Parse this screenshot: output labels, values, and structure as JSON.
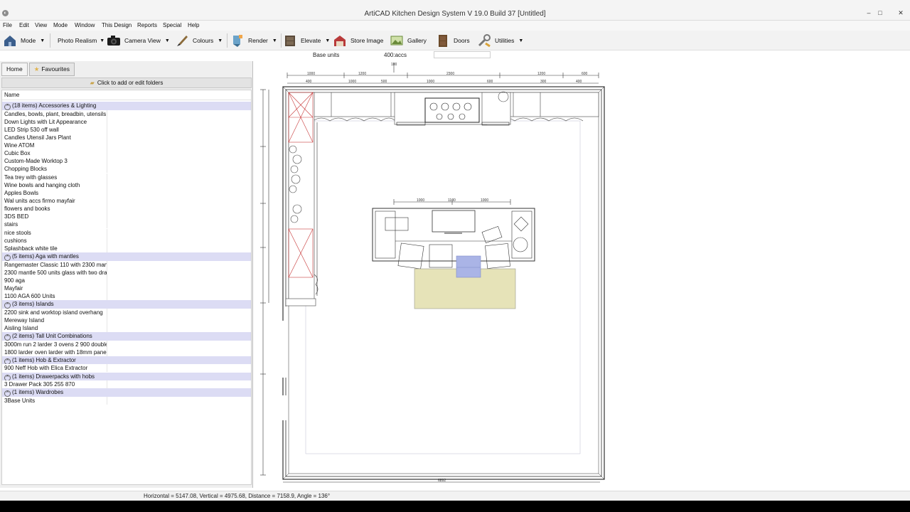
{
  "window": {
    "title": "ArtiCAD Kitchen Design System V 19.0 Build 37 [Untitled]",
    "controls": [
      "–",
      "□",
      "✕"
    ]
  },
  "menu": [
    "File",
    "Edit",
    "View",
    "Mode",
    "Window",
    "This Design",
    "Reports",
    "Special",
    "Help"
  ],
  "toolbar": [
    {
      "label": "Mode",
      "icon": "house-icon"
    },
    {
      "label": "Photo Realism",
      "icon": "photo-realism-icon"
    },
    {
      "label": "Camera View",
      "icon": "camera-icon"
    },
    {
      "label": "Colours",
      "icon": "paintbrush-icon"
    },
    {
      "label": "Render",
      "icon": "render-icon"
    },
    {
      "label": "Elevate",
      "icon": "elevate-icon"
    },
    {
      "label": "Store Image",
      "icon": "store-image-icon"
    },
    {
      "label": "Gallery",
      "icon": "gallery-icon"
    },
    {
      "label": "Doors",
      "icon": "door-icon"
    },
    {
      "label": "Utilities",
      "icon": "utilities-icon"
    }
  ],
  "infobar": {
    "category": "Base units",
    "value": "400:accs"
  },
  "left_panel": {
    "tabs": [
      "Home",
      "Favourites"
    ],
    "folder_button": "Click to add or edit folders",
    "column_header": "Name",
    "rows": [
      {
        "type": "group",
        "label": "(18 items) Accessories & Lighting"
      },
      {
        "type": "item",
        "label": "Candles, bowls, plant, breadbin, utensils"
      },
      {
        "type": "item",
        "label": "Down Lights with Lit Appearance"
      },
      {
        "type": "item",
        "label": "LED Strip 530 off wall"
      },
      {
        "type": "item",
        "label": "Candles Utensil Jars Plant"
      },
      {
        "type": "item",
        "label": "Wine ATOM"
      },
      {
        "type": "item",
        "label": "Cubic Box"
      },
      {
        "type": "item",
        "label": "Custom-Made Worktop 3"
      },
      {
        "type": "item",
        "label": "Chopping Blocks"
      },
      {
        "type": "item",
        "label": "Tea trey with glasses"
      },
      {
        "type": "item",
        "label": "Wine bowls and hanging cloth"
      },
      {
        "type": "item",
        "label": "Apples Bowls"
      },
      {
        "type": "item",
        "label": "Wal units accs firmo mayfair"
      },
      {
        "type": "item",
        "label": "flowers and books"
      },
      {
        "type": "item",
        "label": "3DS BED"
      },
      {
        "type": "item",
        "label": "stairs"
      },
      {
        "type": "item",
        "label": "nice stools"
      },
      {
        "type": "item",
        "label": "cushions"
      },
      {
        "type": "item",
        "label": "Splashback white tile"
      },
      {
        "type": "group",
        "label": "(5 items) Aga with mantles"
      },
      {
        "type": "item",
        "label": "Rangemaster Classic 110 with 2300 mantle"
      },
      {
        "type": "item",
        "label": "2300 mantle 500 units glass with two drawers"
      },
      {
        "type": "item",
        "label": "900 aga"
      },
      {
        "type": "item",
        "label": "Mayfair"
      },
      {
        "type": "item",
        "label": "1100 AGA 600 Units"
      },
      {
        "type": "group",
        "label": "(3 items) Islands"
      },
      {
        "type": "item",
        "label": "2200 sink and worktop island overhang"
      },
      {
        "type": "item",
        "label": "Mereway  Island"
      },
      {
        "type": "item",
        "label": "Aisling Island"
      },
      {
        "type": "group",
        "label": "(2 items) Tall Unit Combinations"
      },
      {
        "type": "item",
        "label": "3000m run 2 larder 3 ovens 2 900 double"
      },
      {
        "type": "item",
        "label": "1800 larder oven larder with 18mm panel"
      },
      {
        "type": "group",
        "label": "(1 items) Hob & Extractor"
      },
      {
        "type": "item",
        "label": "900 Neff Hob with Elica Extractor"
      },
      {
        "type": "group",
        "label": "(1 items) Drawerpacks with hobs"
      },
      {
        "type": "item",
        "label": "3 Drawer Pack 305 255 870"
      },
      {
        "type": "group",
        "label": "(1 items) Wardrobes"
      },
      {
        "type": "item",
        "label": "3Base Units"
      }
    ]
  },
  "drawing": {
    "top_dims": [
      "1000",
      "1200",
      "2300",
      "1200",
      "600"
    ],
    "top_dims_inner": [
      "400",
      "1000",
      "500",
      "1000",
      "600",
      "300",
      "400"
    ],
    "island_dims": [
      "1000",
      "1100",
      "1000"
    ],
    "bottom_dim": "6892",
    "top_mark": "100"
  },
  "status": {
    "text": "Horizontal = 5147.08, Vertical = 4975.68, Distance = 7158.9, Angle = 136°"
  }
}
